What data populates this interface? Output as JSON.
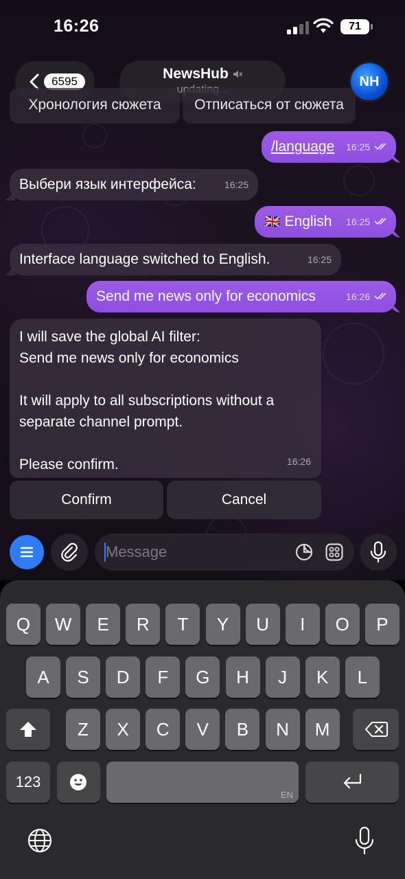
{
  "status_bar": {
    "time": "16:26",
    "battery": "71"
  },
  "header": {
    "back_count": "6595",
    "title": "NewsHub",
    "subtitle": "updating...",
    "avatar_initials": "NH"
  },
  "top_buttons": [
    {
      "label": "Хронология сюжета"
    },
    {
      "label": "Отписаться от сюжета"
    }
  ],
  "messages": [
    {
      "direction": "out",
      "text": "/language",
      "time": "16:25"
    },
    {
      "direction": "in",
      "text": "Выбери язык интерфейса:",
      "time": "16:25"
    },
    {
      "direction": "out",
      "flag": "🇬🇧",
      "text": "English",
      "time": "16:25"
    },
    {
      "direction": "in",
      "text": "Interface language switched to English.",
      "time": "16:25"
    },
    {
      "direction": "out",
      "text": "Send me news only for economics",
      "time": "16:26"
    },
    {
      "direction": "in",
      "lines": [
        "I will save the global AI filter:",
        "Send me news only for economics",
        "",
        "It will apply to all subscriptions without a",
        "separate channel prompt.",
        "",
        "Please confirm."
      ],
      "time": "16:26"
    }
  ],
  "inline_buttons": [
    {
      "label": "Confirm"
    },
    {
      "label": "Cancel"
    }
  ],
  "composer": {
    "placeholder": "Message"
  },
  "keyboard": {
    "row1": [
      "Q",
      "W",
      "E",
      "R",
      "T",
      "Y",
      "U",
      "I",
      "O",
      "P"
    ],
    "row2": [
      "A",
      "S",
      "D",
      "F",
      "G",
      "H",
      "J",
      "K",
      "L"
    ],
    "row3": [
      "Z",
      "X",
      "C",
      "V",
      "B",
      "N",
      "M"
    ],
    "numbers_key": "123",
    "space_lang": "EN"
  },
  "colors": {
    "outgoing_bubble": "#9d5be6",
    "accent_blue": "#2f7cf6"
  }
}
